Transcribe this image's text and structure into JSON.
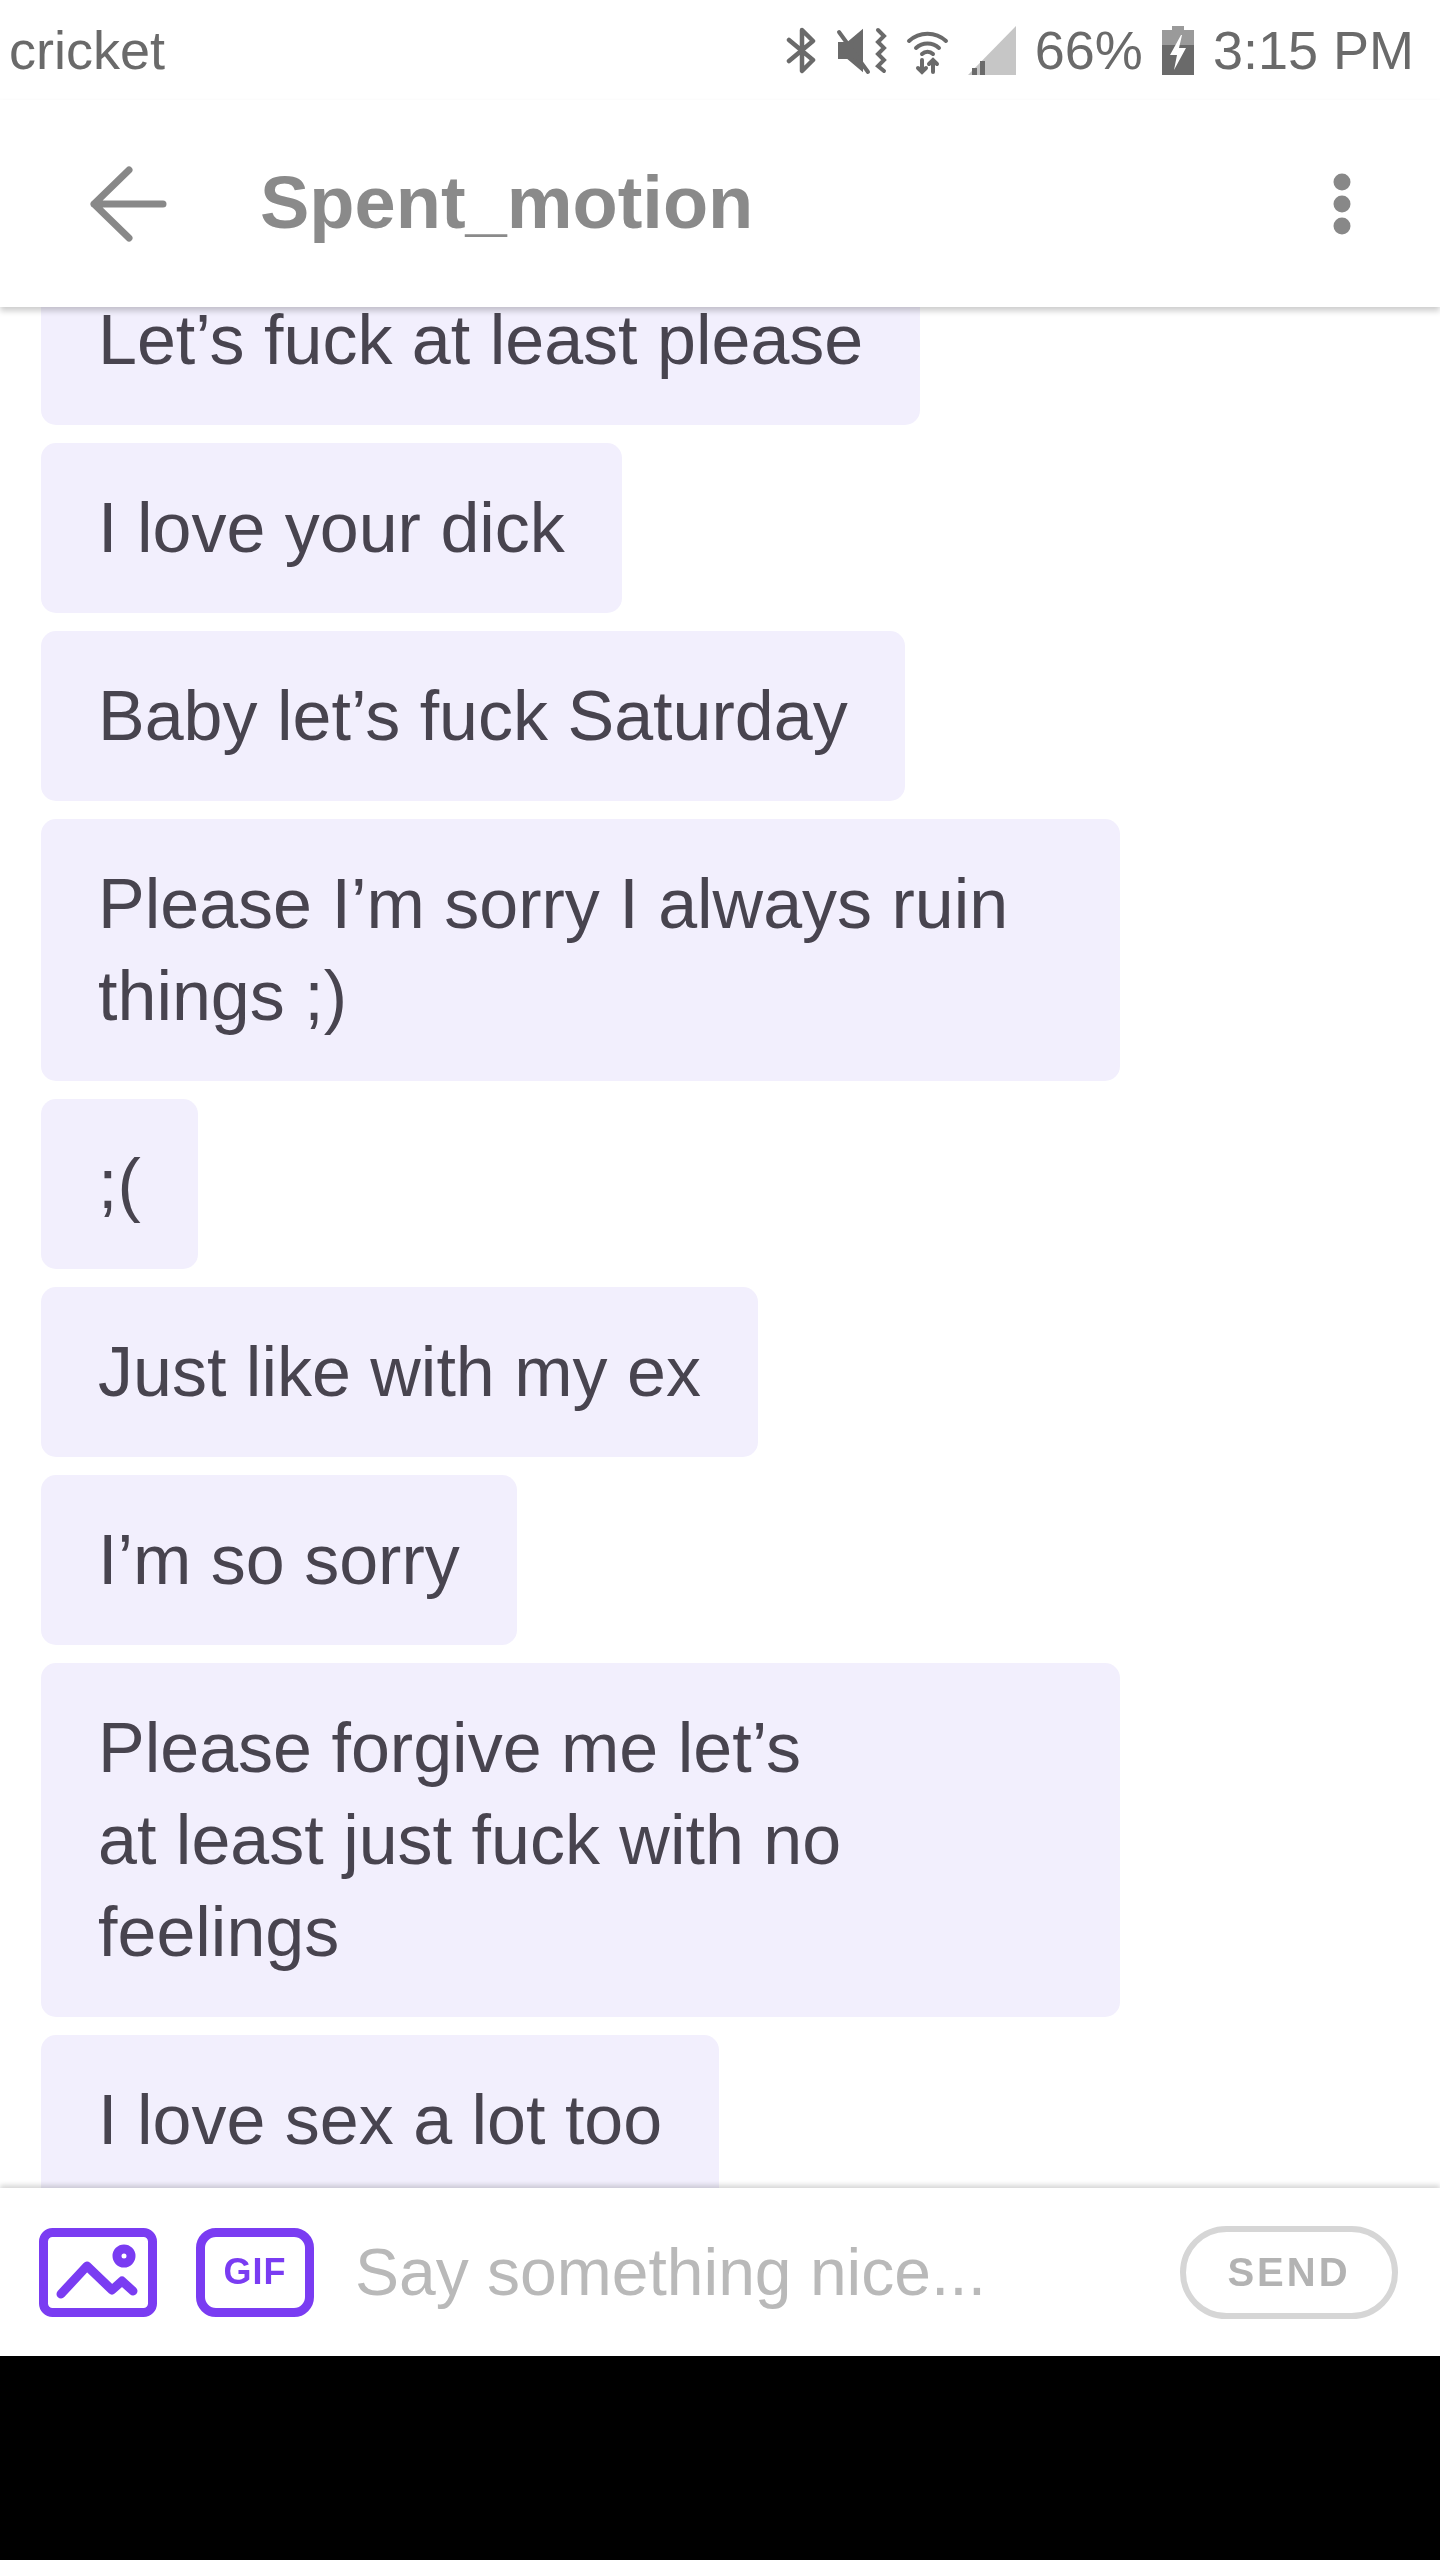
{
  "status_bar": {
    "carrier": "cricket",
    "battery": "66%",
    "time": "3:15 PM"
  },
  "header": {
    "title": "Spent_motion"
  },
  "messages": [
    {
      "text": "Let’s fuck at least please"
    },
    {
      "text": "I love your dick"
    },
    {
      "text": "Baby let’s fuck Saturday"
    },
    {
      "text": "Please I’m sorry I always ruin things ;)"
    },
    {
      "text": ";("
    },
    {
      "text": "Just like with my ex"
    },
    {
      "text": "I’m so sorry"
    },
    {
      "text": "Please forgive me let’s\nat least just fuck with no feelings"
    },
    {
      "text": "I love sex a lot too"
    }
  ],
  "composer": {
    "gif_button": {
      "label": "GIF"
    },
    "input": {
      "placeholder": "Say something nice..."
    },
    "send_button": {
      "label": "SEND",
      "disabled": true
    }
  }
}
